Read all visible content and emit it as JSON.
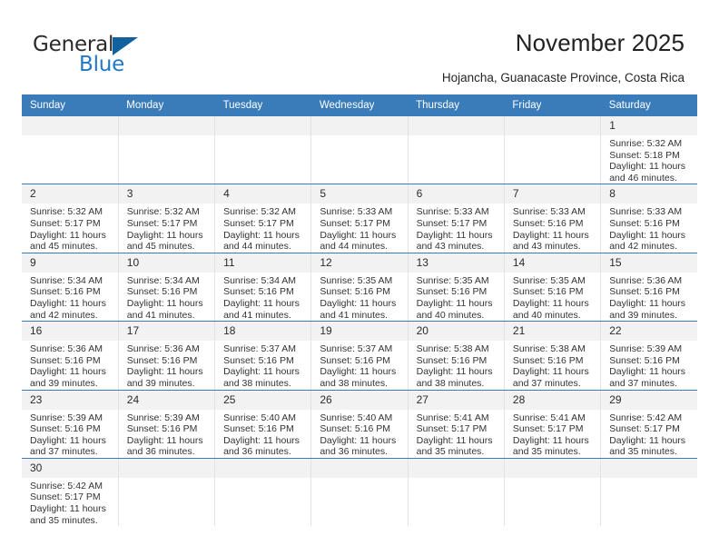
{
  "brand": {
    "name_top": "General",
    "name_bottom": "Blue",
    "accent_color": "#2079c7",
    "triangle_color": "#12619e"
  },
  "header": {
    "title": "November 2025",
    "subtitle": "Hojancha, Guanacaste Province, Costa Rica"
  },
  "theme": {
    "header_row_bg": "#3a7cba",
    "daynum_bg": "#f2f2f2",
    "row_border": "#3a7cba"
  },
  "weekdays": [
    "Sunday",
    "Monday",
    "Tuesday",
    "Wednesday",
    "Thursday",
    "Friday",
    "Saturday"
  ],
  "weeks": [
    [
      {
        "day": "",
        "blank": true
      },
      {
        "day": "",
        "blank": true
      },
      {
        "day": "",
        "blank": true
      },
      {
        "day": "",
        "blank": true
      },
      {
        "day": "",
        "blank": true
      },
      {
        "day": "",
        "blank": true
      },
      {
        "day": "1",
        "sunrise": "Sunrise: 5:32 AM",
        "sunset": "Sunset: 5:18 PM",
        "daylight_1": "Daylight: 11 hours",
        "daylight_2": "and 46 minutes."
      }
    ],
    [
      {
        "day": "2",
        "sunrise": "Sunrise: 5:32 AM",
        "sunset": "Sunset: 5:17 PM",
        "daylight_1": "Daylight: 11 hours",
        "daylight_2": "and 45 minutes."
      },
      {
        "day": "3",
        "sunrise": "Sunrise: 5:32 AM",
        "sunset": "Sunset: 5:17 PM",
        "daylight_1": "Daylight: 11 hours",
        "daylight_2": "and 45 minutes."
      },
      {
        "day": "4",
        "sunrise": "Sunrise: 5:32 AM",
        "sunset": "Sunset: 5:17 PM",
        "daylight_1": "Daylight: 11 hours",
        "daylight_2": "and 44 minutes."
      },
      {
        "day": "5",
        "sunrise": "Sunrise: 5:33 AM",
        "sunset": "Sunset: 5:17 PM",
        "daylight_1": "Daylight: 11 hours",
        "daylight_2": "and 44 minutes."
      },
      {
        "day": "6",
        "sunrise": "Sunrise: 5:33 AM",
        "sunset": "Sunset: 5:17 PM",
        "daylight_1": "Daylight: 11 hours",
        "daylight_2": "and 43 minutes."
      },
      {
        "day": "7",
        "sunrise": "Sunrise: 5:33 AM",
        "sunset": "Sunset: 5:16 PM",
        "daylight_1": "Daylight: 11 hours",
        "daylight_2": "and 43 minutes."
      },
      {
        "day": "8",
        "sunrise": "Sunrise: 5:33 AM",
        "sunset": "Sunset: 5:16 PM",
        "daylight_1": "Daylight: 11 hours",
        "daylight_2": "and 42 minutes."
      }
    ],
    [
      {
        "day": "9",
        "sunrise": "Sunrise: 5:34 AM",
        "sunset": "Sunset: 5:16 PM",
        "daylight_1": "Daylight: 11 hours",
        "daylight_2": "and 42 minutes."
      },
      {
        "day": "10",
        "sunrise": "Sunrise: 5:34 AM",
        "sunset": "Sunset: 5:16 PM",
        "daylight_1": "Daylight: 11 hours",
        "daylight_2": "and 41 minutes."
      },
      {
        "day": "11",
        "sunrise": "Sunrise: 5:34 AM",
        "sunset": "Sunset: 5:16 PM",
        "daylight_1": "Daylight: 11 hours",
        "daylight_2": "and 41 minutes."
      },
      {
        "day": "12",
        "sunrise": "Sunrise: 5:35 AM",
        "sunset": "Sunset: 5:16 PM",
        "daylight_1": "Daylight: 11 hours",
        "daylight_2": "and 41 minutes."
      },
      {
        "day": "13",
        "sunrise": "Sunrise: 5:35 AM",
        "sunset": "Sunset: 5:16 PM",
        "daylight_1": "Daylight: 11 hours",
        "daylight_2": "and 40 minutes."
      },
      {
        "day": "14",
        "sunrise": "Sunrise: 5:35 AM",
        "sunset": "Sunset: 5:16 PM",
        "daylight_1": "Daylight: 11 hours",
        "daylight_2": "and 40 minutes."
      },
      {
        "day": "15",
        "sunrise": "Sunrise: 5:36 AM",
        "sunset": "Sunset: 5:16 PM",
        "daylight_1": "Daylight: 11 hours",
        "daylight_2": "and 39 minutes."
      }
    ],
    [
      {
        "day": "16",
        "sunrise": "Sunrise: 5:36 AM",
        "sunset": "Sunset: 5:16 PM",
        "daylight_1": "Daylight: 11 hours",
        "daylight_2": "and 39 minutes."
      },
      {
        "day": "17",
        "sunrise": "Sunrise: 5:36 AM",
        "sunset": "Sunset: 5:16 PM",
        "daylight_1": "Daylight: 11 hours",
        "daylight_2": "and 39 minutes."
      },
      {
        "day": "18",
        "sunrise": "Sunrise: 5:37 AM",
        "sunset": "Sunset: 5:16 PM",
        "daylight_1": "Daylight: 11 hours",
        "daylight_2": "and 38 minutes."
      },
      {
        "day": "19",
        "sunrise": "Sunrise: 5:37 AM",
        "sunset": "Sunset: 5:16 PM",
        "daylight_1": "Daylight: 11 hours",
        "daylight_2": "and 38 minutes."
      },
      {
        "day": "20",
        "sunrise": "Sunrise: 5:38 AM",
        "sunset": "Sunset: 5:16 PM",
        "daylight_1": "Daylight: 11 hours",
        "daylight_2": "and 38 minutes."
      },
      {
        "day": "21",
        "sunrise": "Sunrise: 5:38 AM",
        "sunset": "Sunset: 5:16 PM",
        "daylight_1": "Daylight: 11 hours",
        "daylight_2": "and 37 minutes."
      },
      {
        "day": "22",
        "sunrise": "Sunrise: 5:39 AM",
        "sunset": "Sunset: 5:16 PM",
        "daylight_1": "Daylight: 11 hours",
        "daylight_2": "and 37 minutes."
      }
    ],
    [
      {
        "day": "23",
        "sunrise": "Sunrise: 5:39 AM",
        "sunset": "Sunset: 5:16 PM",
        "daylight_1": "Daylight: 11 hours",
        "daylight_2": "and 37 minutes."
      },
      {
        "day": "24",
        "sunrise": "Sunrise: 5:39 AM",
        "sunset": "Sunset: 5:16 PM",
        "daylight_1": "Daylight: 11 hours",
        "daylight_2": "and 36 minutes."
      },
      {
        "day": "25",
        "sunrise": "Sunrise: 5:40 AM",
        "sunset": "Sunset: 5:16 PM",
        "daylight_1": "Daylight: 11 hours",
        "daylight_2": "and 36 minutes."
      },
      {
        "day": "26",
        "sunrise": "Sunrise: 5:40 AM",
        "sunset": "Sunset: 5:16 PM",
        "daylight_1": "Daylight: 11 hours",
        "daylight_2": "and 36 minutes."
      },
      {
        "day": "27",
        "sunrise": "Sunrise: 5:41 AM",
        "sunset": "Sunset: 5:17 PM",
        "daylight_1": "Daylight: 11 hours",
        "daylight_2": "and 35 minutes."
      },
      {
        "day": "28",
        "sunrise": "Sunrise: 5:41 AM",
        "sunset": "Sunset: 5:17 PM",
        "daylight_1": "Daylight: 11 hours",
        "daylight_2": "and 35 minutes."
      },
      {
        "day": "29",
        "sunrise": "Sunrise: 5:42 AM",
        "sunset": "Sunset: 5:17 PM",
        "daylight_1": "Daylight: 11 hours",
        "daylight_2": "and 35 minutes."
      }
    ],
    [
      {
        "day": "30",
        "sunrise": "Sunrise: 5:42 AM",
        "sunset": "Sunset: 5:17 PM",
        "daylight_1": "Daylight: 11 hours",
        "daylight_2": "and 35 minutes."
      },
      {
        "day": "",
        "empty": true
      },
      {
        "day": "",
        "empty": true
      },
      {
        "day": "",
        "empty": true
      },
      {
        "day": "",
        "empty": true
      },
      {
        "day": "",
        "empty": true
      },
      {
        "day": "",
        "empty": true
      }
    ]
  ]
}
